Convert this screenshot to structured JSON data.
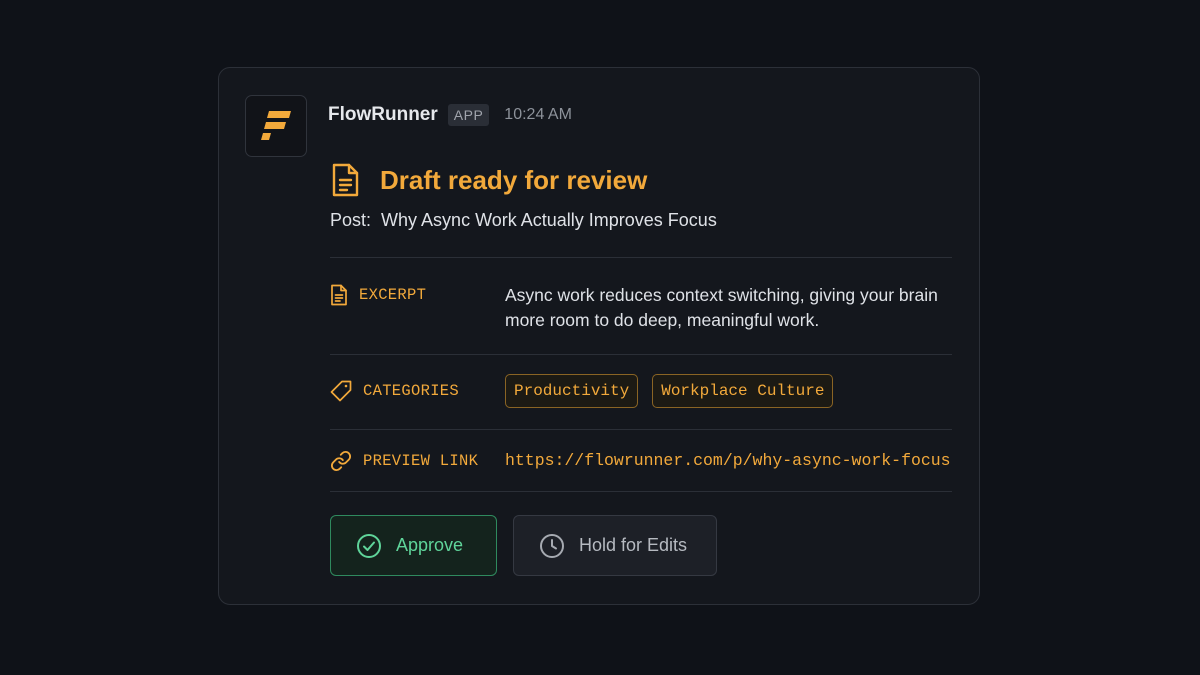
{
  "message": {
    "app_name": "FlowRunner",
    "app_badge": "APP",
    "timestamp": "10:24 AM",
    "avatar_icon": "flowrunner-logo-icon",
    "title": "Draft ready for review",
    "title_icon": "document-icon",
    "post_prefix": "Post:",
    "post_title": "Why Async Work Actually Improves Focus"
  },
  "fields": {
    "excerpt": {
      "label": "EXCERPT",
      "icon": "document-icon",
      "text": "Async work reduces context switching, giving your brain more room to do deep, meaningful work."
    },
    "categories": {
      "label": "CATEGORIES",
      "icon": "tag-icon",
      "items": [
        "Productivity",
        "Workplace Culture"
      ]
    },
    "preview": {
      "label": "PREVIEW LINK",
      "icon": "link-icon",
      "url": "https://flowrunner.com/p/why-async-work-focus"
    }
  },
  "actions": {
    "approve": {
      "label": "Approve",
      "icon": "check-circle-icon"
    },
    "hold": {
      "label": "Hold for Edits",
      "icon": "clock-icon"
    }
  },
  "colors": {
    "accent": "#f2a93b",
    "approve": "#5fd49a",
    "background": "#0f1218",
    "card": "#14171d"
  }
}
